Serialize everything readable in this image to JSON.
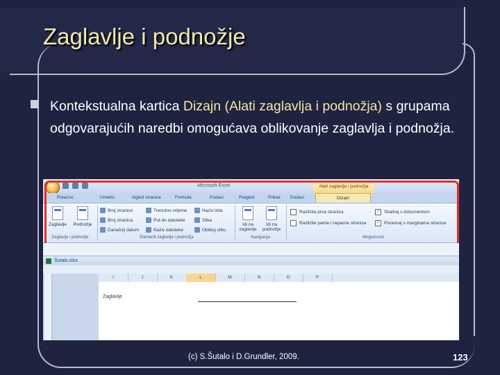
{
  "slide": {
    "title": "Zaglavlje i podnožje",
    "bullet_text_before": "Kontekstualna kartica ",
    "bullet_highlight": "Dizajn (Alati zaglavlja i podnožja)",
    "bullet_text_after": " s grupama odgovarajućih naredbi omogućava oblikovanje zaglavlja i podnožja.",
    "footer_credit": "(c) S.Šutalo i D.Grundler, 2009.",
    "page_number": "123",
    "title_color": "#f2e7a8",
    "background_color": "#1f2340"
  },
  "excel": {
    "app_title": "Microsoft Excel",
    "context_tab_title": "Alati zaglavlja i podnožja",
    "tabs": [
      "Polazno",
      "Umetni",
      "Izgled stranice",
      "Formule",
      "Podaci",
      "Pregled",
      "Prikaz",
      "Dodaci",
      "Dizajn"
    ],
    "active_tab": "Dizajn",
    "groups": {
      "group1_label": "Zaglavlje i podnožje",
      "btn_zaglavlje": "Zaglavlje",
      "btn_podnozje": "Podnožje",
      "group2_label": "Elementi zaglavlja i podnožja",
      "elements": [
        "Broj stranice",
        "Broj stranica",
        "Današnji datum",
        "Trenutno vrijeme",
        "Put do datoteke",
        "Naziv datoteke",
        "Naziv lista",
        "Slika",
        "Oblikuj sliku"
      ],
      "group3_label": "Navigacija",
      "btn_idi_zaglavlje": "Idi na zaglavlje",
      "btn_idi_podnozje": "Idi na podnožje",
      "group4_label": "Mogućnosti",
      "options": [
        {
          "label": "Različita prva stranica",
          "checked": false
        },
        {
          "label": "Različite parne i neparne stranice",
          "checked": false
        },
        {
          "label": "Skaliraj s dokumentom",
          "checked": true
        },
        {
          "label": "Poravnaj s marginama stranice",
          "checked": true
        }
      ]
    },
    "workbook_title": "Šutalo.xlsx",
    "columns": [
      "I",
      "J",
      "K",
      "L",
      "M",
      "N",
      "O",
      "P"
    ],
    "selected_column": "L",
    "header_label": "Zaglavlje",
    "outline_color": "#e23227"
  }
}
